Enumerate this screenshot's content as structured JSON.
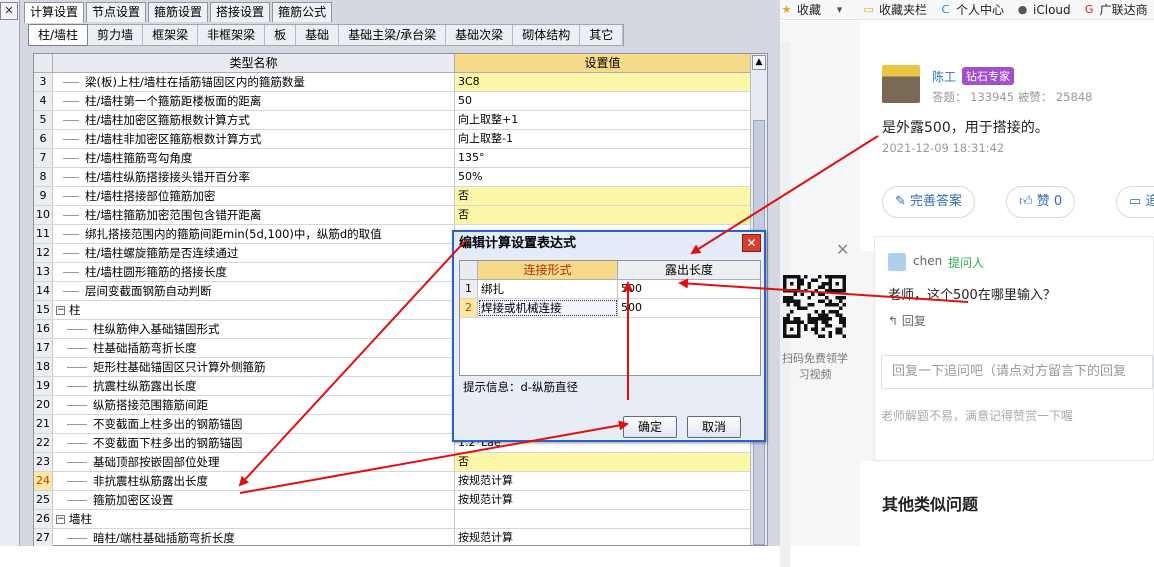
{
  "app": {
    "close_glyph": "✕",
    "top_tabs": [
      "计算设置",
      "节点设置",
      "箍筋设置",
      "搭接设置",
      "箍筋公式"
    ],
    "top_tab_active": 0,
    "sub_tabs": [
      "柱/墙柱",
      "剪力墙",
      "框架梁",
      "非框架梁",
      "板",
      "基础",
      "基础主梁/承台梁",
      "基础次梁",
      "砌体结构",
      "其它"
    ],
    "sub_tab_active": 0,
    "grid": {
      "headers": {
        "name": "类型名称",
        "value": "设置值"
      },
      "rows": [
        {
          "num": "3",
          "name": "梁(板)上柱/墙柱在插筋锚固区内的箍筋数量",
          "value": "3C8",
          "yellow": true
        },
        {
          "num": "4",
          "name": "柱/墙柱第一个箍筋距楼板面的距离",
          "value": "50",
          "yellow": false
        },
        {
          "num": "5",
          "name": "柱/墙柱加密区箍筋根数计算方式",
          "value": "向上取整+1",
          "yellow": false
        },
        {
          "num": "6",
          "name": "柱/墙柱非加密区箍筋根数计算方式",
          "value": "向上取整-1",
          "yellow": false
        },
        {
          "num": "7",
          "name": "柱/墙柱箍筋弯勾角度",
          "value": "135°",
          "yellow": false
        },
        {
          "num": "8",
          "name": "柱/墙柱纵筋搭接接头错开百分率",
          "value": "50%",
          "yellow": false
        },
        {
          "num": "9",
          "name": "柱/墙柱搭接部位箍筋加密",
          "value": "否",
          "yellow": true
        },
        {
          "num": "10",
          "name": "柱/墙柱箍筋加密范围包含错开距离",
          "value": "否",
          "yellow": true
        },
        {
          "num": "11",
          "name": "绑扎搭接范围内的箍筋间距min(5d,100)中，纵筋d的取值",
          "value": "",
          "yellow": false
        },
        {
          "num": "12",
          "name": "柱/墙柱螺旋箍筋是否连续通过",
          "value": "",
          "yellow": false
        },
        {
          "num": "13",
          "name": "柱/墙柱圆形箍筋的搭接长度",
          "value": "",
          "yellow": false
        },
        {
          "num": "14",
          "name": "层间变截面钢筋自动判断",
          "value": "",
          "yellow": false
        },
        {
          "num": "15",
          "name": "柱",
          "value": "",
          "yellow": false,
          "group": true
        },
        {
          "num": "16",
          "name": "柱纵筋伸入基础锚固形式",
          "value": "",
          "yellow": false
        },
        {
          "num": "17",
          "name": "柱基础插筋弯折长度",
          "value": "",
          "yellow": false
        },
        {
          "num": "18",
          "name": "矩形柱基础锚固区只计算外侧箍筋",
          "value": "",
          "yellow": false
        },
        {
          "num": "19",
          "name": "抗震柱纵筋露出长度",
          "value": "",
          "yellow": false
        },
        {
          "num": "20",
          "name": "纵筋搭接范围箍筋间距",
          "value": "",
          "yellow": false
        },
        {
          "num": "21",
          "name": "不变截面上柱多出的钢筋锚固",
          "value": "",
          "yellow": false
        },
        {
          "num": "22",
          "name": "不变截面下柱多出的钢筋锚固",
          "value": "1.2*Lae",
          "yellow": false
        },
        {
          "num": "23",
          "name": "基础顶部按嵌固部位处理",
          "value": "否",
          "yellow": true
        },
        {
          "num": "24",
          "name": "非抗震柱纵筋露出长度",
          "value": "按规范计算",
          "yellow": false,
          "highlight": true
        },
        {
          "num": "25",
          "name": "箍筋加密区设置",
          "value": "按规范计算",
          "yellow": false
        },
        {
          "num": "26",
          "name": "墙柱",
          "value": "",
          "yellow": false,
          "group": true
        },
        {
          "num": "27",
          "name": "暗柱/端柱基础插筋弯折长度",
          "value": "按规范计算",
          "yellow": false
        }
      ]
    },
    "dialog": {
      "title": "编辑计算设置表达式",
      "close_glyph": "✕",
      "headers": {
        "col1": "连接形式",
        "col2": "露出长度"
      },
      "rows": [
        {
          "num": "1",
          "type": "绑扎",
          "length": "500"
        },
        {
          "num": "2",
          "type": "焊接或机械连接",
          "length": "500"
        }
      ],
      "hint": "提示信息：d-纵筋直径",
      "ok": "确定",
      "cancel": "取消"
    }
  },
  "browser": {
    "bookmarks": [
      {
        "icon": "★",
        "label": "收藏",
        "color": "#f0a020"
      },
      {
        "icon": "▾",
        "label": "",
        "color": "#555"
      },
      {
        "icon": "▭",
        "label": "收藏夹栏",
        "color": "#e0b040"
      },
      {
        "icon": "ᑕ",
        "label": "个人中心",
        "color": "#1a8ce8"
      },
      {
        "icon": "●",
        "label": "iCloud",
        "color": "#555"
      },
      {
        "icon": "G",
        "label": "广联达商",
        "color": "#d02020"
      }
    ],
    "answer": {
      "name": "陈工",
      "badge": "钻石专家",
      "stats": "答题： 133945    被赞： 25848",
      "text": "是外露500，用于搭接的。",
      "time": "2021-12-09 18:31:42",
      "btn_complete": "完善答案",
      "btn_like": "赞 0",
      "btn_more": "追"
    },
    "close_glyph": "✕",
    "qr_caption": "扫码免费领学习视频",
    "followup": {
      "name": "chen",
      "tag": "提问人",
      "text": "老师，这个500在哪里输入？",
      "reply": "回复",
      "input_placeholder": "回复一下追问吧（请点对方留言下的回复",
      "hint": "老师解题不易，满意记得赞赏一下喔"
    },
    "similar_title": "其他类似问题"
  }
}
